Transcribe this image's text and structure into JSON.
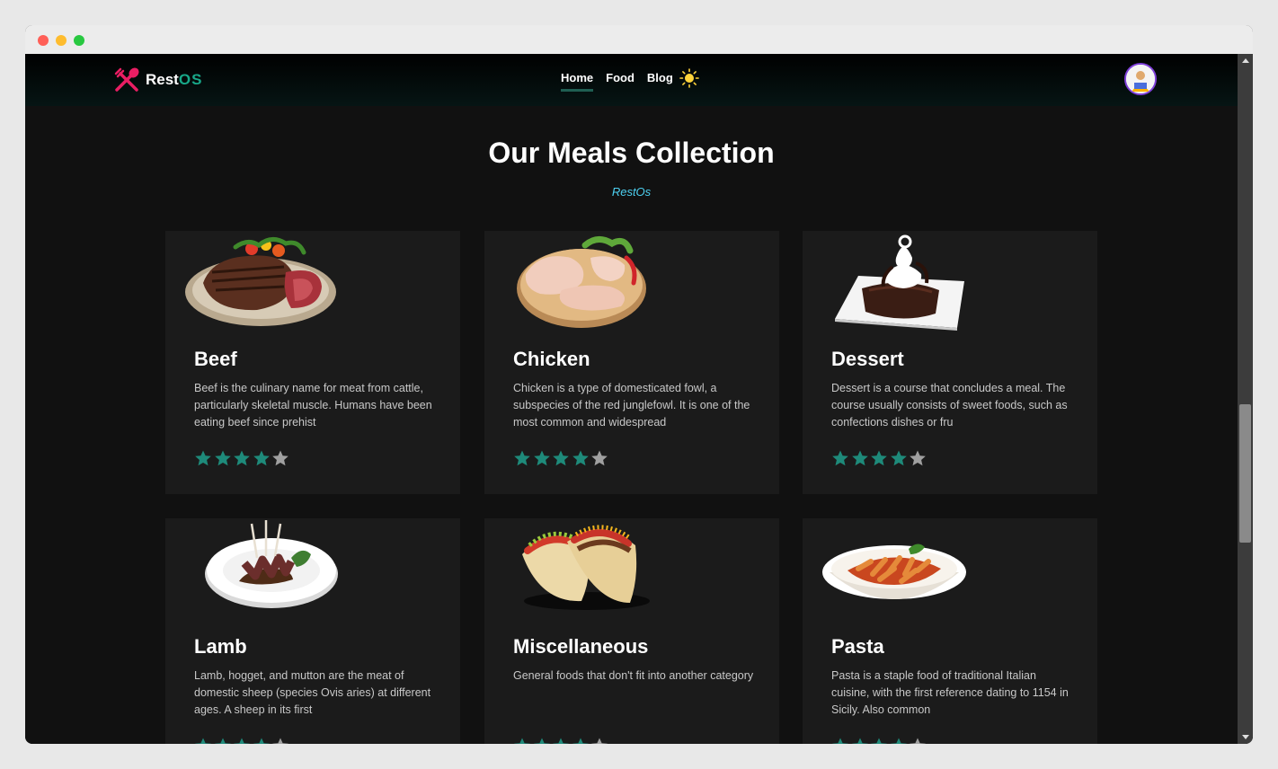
{
  "brand": {
    "name_main": "Rest",
    "name_accent": "OS",
    "logo_icon": "spoon-fork-cross-icon"
  },
  "nav": {
    "links": [
      {
        "label": "Home",
        "active": true
      },
      {
        "label": "Food",
        "active": false
      },
      {
        "label": "Blog",
        "active": false
      }
    ],
    "theme_icon": "sun-icon",
    "avatar_icon": "user-avatar"
  },
  "hero": {
    "title": "Our Meals Collection",
    "subtitle": "RestOs"
  },
  "colors": {
    "accent": "#18a889",
    "brand_pink": "#e91e63",
    "star_filled": "#1e8a7a",
    "star_empty": "#a0a0a0",
    "subtitle": "#4dd0f0"
  },
  "cards": [
    {
      "title": "Beef",
      "desc": "Beef is the culinary name for meat from cattle, particularly skeletal muscle. Humans have been eating beef since prehist",
      "rating": 4,
      "max_rating": 5,
      "image": "steak-plate"
    },
    {
      "title": "Chicken",
      "desc": "Chicken is a type of domesticated fowl, a subspecies of the red junglefowl. It is one of the most common and widespread",
      "rating": 4,
      "max_rating": 5,
      "image": "chicken-legs-board"
    },
    {
      "title": "Dessert",
      "desc": "Dessert is a course that concludes a meal. The course usually consists of sweet foods, such as confections dishes or fru",
      "rating": 4,
      "max_rating": 5,
      "image": "chocolate-cake-plate"
    },
    {
      "title": "Lamb",
      "desc": "Lamb, hogget, and mutton are the meat of domestic sheep (species Ovis aries) at different ages. A sheep in its first",
      "rating": 4,
      "max_rating": 5,
      "image": "lamb-rack-plate"
    },
    {
      "title": "Miscellaneous",
      "desc": "General foods that don't fit into another category",
      "rating": 4,
      "max_rating": 5,
      "image": "tacos"
    },
    {
      "title": "Pasta",
      "desc": "Pasta is a staple food of traditional Italian cuisine, with the first reference dating to 1154 in Sicily. Also common",
      "rating": 4,
      "max_rating": 5,
      "image": "penne-pasta-bowl"
    }
  ]
}
